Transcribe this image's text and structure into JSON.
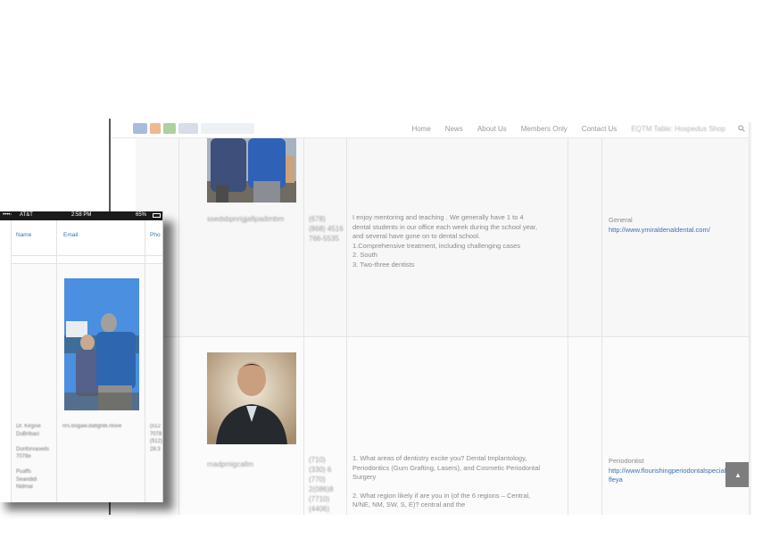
{
  "desktop": {
    "nav": {
      "items": [
        {
          "label": "Home"
        },
        {
          "label": "News"
        },
        {
          "label": "About Us"
        },
        {
          "label": "Members Only"
        },
        {
          "label": "Contact Us"
        }
      ],
      "blurred_item": "EQTM Table: Hospedus Shop"
    },
    "rows": [
      {
        "name_blurred": "ssedsbpnrigjafipadimbm",
        "phone_blurred": "(678)\n(868) 4516\n766-5535",
        "answers": [
          "I enjoy mentoring and teaching . We generally have 1 to 4",
          "dental students in our office each week during the school year,",
          "and several have gone on to dental school.",
          "1.Comprehensive treatment, including challenging cases",
          "2. South",
          "3. Two-three dentists"
        ],
        "category": "General",
        "website": "http://www.ymiraldenaldental.com/"
      },
      {
        "name_blurred": "rnadpmigcallm",
        "phone_blurred": "(710)\n(330) 6\n(770)\n2(086)8\n(7710)\n(4406)",
        "answers": [
          "1. What areas of dentistry excite you? Dental Implantology,",
          "Periodontics (Gum Grafting, Lasers), and Cosmetic Periodontal",
          "Surgery",
          "",
          "2. What region likely if are you in (of the 6 regions – Central,",
          "N/NE, NM, SW, S, E)? central and the"
        ],
        "category": "Periodontist",
        "website": "http://www.flourishingperiodontalspecialist\nfleya"
      }
    ],
    "scroll_top_icon": "chevron-up-icon"
  },
  "phone": {
    "status": {
      "carrier": "AT&T",
      "time": "2:58 PM",
      "battery": "65%"
    },
    "headers": [
      "Name",
      "Email",
      "Pho"
    ],
    "name_blurred": "Dr. Kirgise\nDuBribaci\n\nDonforvaseds\n7078e\n\nPuaffs\nSeandidi\nNidmai",
    "email_blurred": "nrs.bogaw.dabgnbi.nlove",
    "phone_blurred": "(512\n7078\n(512)\n28:3"
  }
}
